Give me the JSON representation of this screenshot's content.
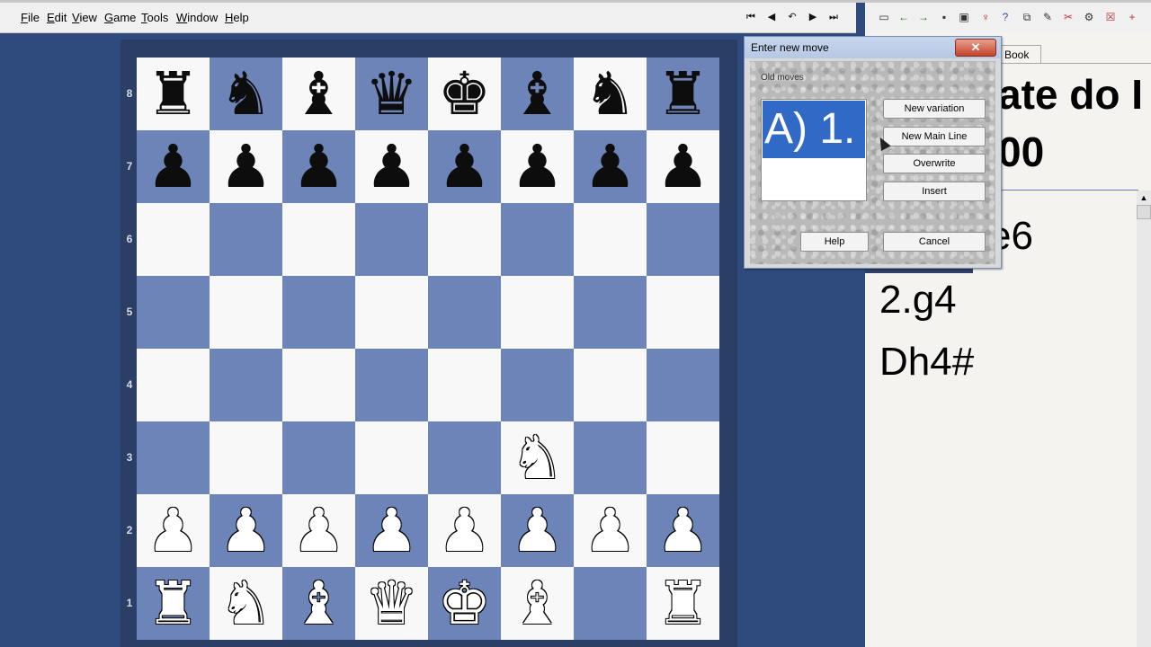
{
  "menu": [
    {
      "label": "File",
      "key": "F"
    },
    {
      "label": "Edit",
      "key": "E"
    },
    {
      "label": "View",
      "key": "V"
    },
    {
      "label": "Game",
      "key": "G"
    },
    {
      "label": "Tools",
      "key": "T"
    },
    {
      "label": "Window",
      "key": "W"
    },
    {
      "label": "Help",
      "key": "H"
    }
  ],
  "nav_icons": [
    "first-move-icon",
    "previous-move-icon",
    "undo-icon",
    "next-move-icon",
    "last-move-icon"
  ],
  "toolbar_icons": [
    "new-icon",
    "back-arrow-icon",
    "forward-arrow-icon",
    "save-icon",
    "save-as-icon",
    "analysis-icon",
    "help-icon",
    "copy-position-icon",
    "eraser-icon",
    "delete-icon",
    "tournament-icon",
    "close-icon",
    "add-icon"
  ],
  "board": {
    "ranks": [
      "8",
      "7",
      "6",
      "5",
      "4",
      "3",
      "2",
      "1"
    ],
    "pieces": [
      [
        "r",
        "n",
        "b",
        "q",
        "k",
        "b",
        "n",
        "r"
      ],
      [
        "p",
        "p",
        "p",
        "p",
        "p",
        "p",
        "p",
        "p"
      ],
      [
        "",
        "",
        "",
        "",
        "",
        "",
        "",
        ""
      ],
      [
        "",
        "",
        "",
        "",
        "",
        "",
        "",
        ""
      ],
      [
        "",
        "",
        "",
        "",
        "",
        "",
        "",
        ""
      ],
      [
        "",
        "",
        "",
        "",
        "",
        "N",
        "",
        ""
      ],
      [
        "P",
        "P",
        "P",
        "P",
        "P",
        "P",
        "P",
        "P"
      ],
      [
        "R",
        "N",
        "B",
        "Q",
        "K",
        "B",
        "",
        "R"
      ]
    ]
  },
  "right_panel": {
    "tab_label": "Book",
    "title_line1": "ate do I",
    "title_line2": "00",
    "moves": [
      "e6",
      "2.g4",
      "Dh4#"
    ]
  },
  "dialog": {
    "title": "Enter new move",
    "close_label": "✕",
    "old_moves_label": "Old moves",
    "selected_move": "A) 1.",
    "buttons": {
      "new_variation": "New variation",
      "new_main_line": "New Main Line",
      "overwrite": "Overwrite",
      "insert": "Insert",
      "help": "Help",
      "cancel": "Cancel"
    }
  },
  "colors": {
    "board_light": "#f8f8f8",
    "board_dark": "#6c84b8",
    "background": "#2f4a7c",
    "selection": "#3169c6"
  }
}
